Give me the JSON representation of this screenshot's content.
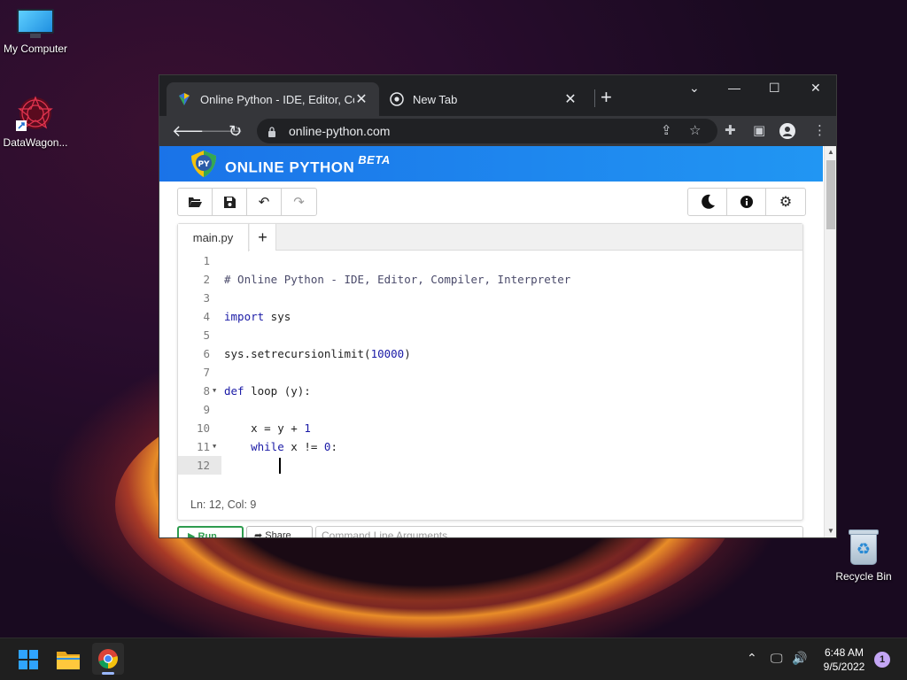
{
  "desktop": {
    "icons": [
      {
        "label": "My Computer",
        "icon": "monitor-icon"
      },
      {
        "label": "DataWagon...",
        "icon": "datawagon-icon"
      },
      {
        "label": "Recycle Bin",
        "icon": "recycle-bin-icon"
      }
    ]
  },
  "browser": {
    "tabs": [
      {
        "title": "Online Python - IDE, Editor, Comp",
        "active": true
      },
      {
        "title": "New Tab",
        "active": false
      }
    ],
    "new_tab_label": "+",
    "window_controls": {
      "minimize": "—",
      "maximize": "☐",
      "close": "✕",
      "tab_search": "⌄"
    },
    "url": "online-python.com"
  },
  "site": {
    "brand": "ONLINE PYTHON",
    "brand_badge": "BETA",
    "logo_text": "PY",
    "editor_tab": "main.py",
    "add_tab": "+",
    "code_lines": [
      {
        "num": "1",
        "text": ""
      },
      {
        "num": "2",
        "text": "# Online Python - IDE, Editor, Compiler, Interpreter"
      },
      {
        "num": "3",
        "text": ""
      },
      {
        "num": "4",
        "text": "import sys"
      },
      {
        "num": "5",
        "text": ""
      },
      {
        "num": "6",
        "text": "sys.setrecursionlimit(10000)"
      },
      {
        "num": "7",
        "text": ""
      },
      {
        "num": "8",
        "text": "def loop (y):"
      },
      {
        "num": "9",
        "text": ""
      },
      {
        "num": "10",
        "text": "    x = y + 1"
      },
      {
        "num": "11",
        "text": "    while x != 0:"
      },
      {
        "num": "12",
        "text": "        "
      }
    ],
    "status": "Ln: 12,  Col: 9",
    "run_label": "Run",
    "share_label": "Share",
    "cmd_placeholder": "Command Line Arguments"
  },
  "taskbar": {
    "time": "6:48 AM",
    "date": "9/5/2022",
    "notification_count": "1"
  },
  "colors": {
    "banner_start": "#1a73e8",
    "banner_end": "#2196f3",
    "keyword": "#1a1aa6",
    "run_green": "#2e9b4e",
    "chrome_dark": "#202124"
  }
}
